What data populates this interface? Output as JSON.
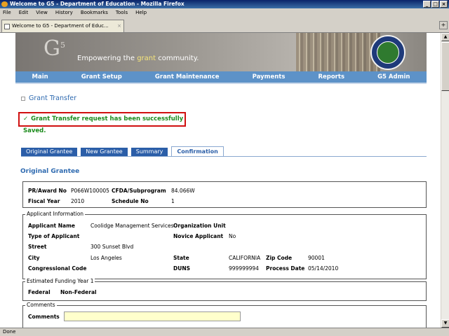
{
  "window": {
    "title": "Welcome to G5 - Department of Education - Mozilla Firefox",
    "buttons": [
      "_",
      "□",
      "×"
    ]
  },
  "menu": [
    "File",
    "Edit",
    "View",
    "History",
    "Bookmarks",
    "Tools",
    "Help"
  ],
  "browser_tab": {
    "label": "Welcome to G5 - Department of Educ...",
    "close": "×",
    "new_tab": "+"
  },
  "banner": {
    "logo": "G",
    "logo_sup": "5",
    "tagline_pre": "Empowering the ",
    "tagline_hl": "grant",
    "tagline_post": " community."
  },
  "nav": [
    "Main",
    "Grant Setup",
    "Grant Maintenance",
    "Payments",
    "Reports",
    "G5 Admin"
  ],
  "page_title": "Grant Transfer",
  "success_message": "Grant Transfer request has been successfully Saved.",
  "success_icon": "✓",
  "tabs": [
    "Original Grantee",
    "New Grantee",
    "Summary",
    "Confirmation"
  ],
  "section_title": "Original Grantee",
  "award": {
    "pr_label": "PR/Award No",
    "pr_value": "P066W100005",
    "cfda_label": "CFDA/Subprogram",
    "cfda_value": "84.066W",
    "fy_label": "Fiscal Year",
    "fy_value": "2010",
    "sched_label": "Schedule No",
    "sched_value": "1"
  },
  "applicant": {
    "legend": "Applicant Information",
    "name_label": "Applicant Name",
    "name_value": "Coolidge Management Services",
    "org_label": "Organization Unit",
    "type_label": "Type of Applicant",
    "novice_label": "Novice Applicant",
    "novice_value": "No",
    "street_label": "Street",
    "street_value": "300 Sunset Blvd",
    "city_label": "City",
    "city_value": "Los Angeles",
    "state_label": "State",
    "state_value": "CALIFORNIA",
    "zip_label": "Zip Code",
    "zip_value": "90001",
    "cong_label": "Congressional Code",
    "duns_label": "DUNS",
    "duns_value": "999999994",
    "process_label": "Process Date",
    "process_value": "05/14/2010"
  },
  "funding": {
    "legend": "Estimated Funding Year 1",
    "federal_label": "Federal",
    "federal_value": "Non-Federal"
  },
  "comments": {
    "legend": "Comments",
    "label": "Comments",
    "value": ""
  },
  "status": "Done"
}
